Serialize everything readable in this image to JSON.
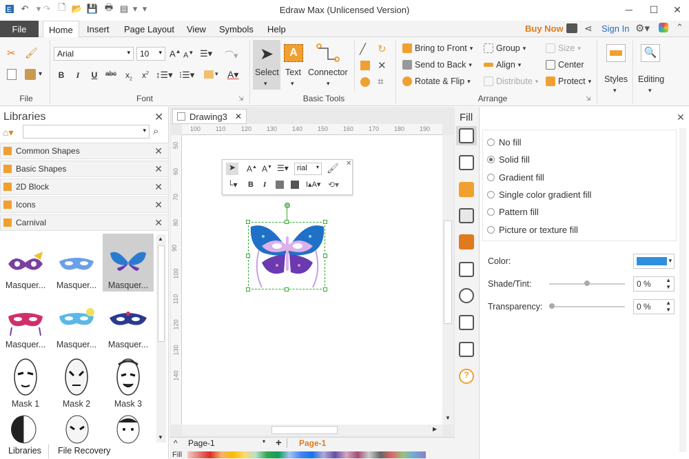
{
  "window": {
    "title": "Edraw Max (Unlicensed Version)"
  },
  "menu_tabs": [
    "File",
    "Home",
    "Insert",
    "Page Layout",
    "View",
    "Symbols",
    "Help"
  ],
  "header_right": {
    "buy_now": "Buy Now",
    "sign_in": "Sign In"
  },
  "ribbon": {
    "file_group": {
      "label": "File"
    },
    "font_group": {
      "label": "Font",
      "font_name": "Arial",
      "font_size": "10"
    },
    "basic_tools": {
      "label": "Basic Tools",
      "select": "Select",
      "text": "Text",
      "connector": "Connector"
    },
    "arrange": {
      "label": "Arrange",
      "bring_to_front": "Bring to Front",
      "send_to_back": "Send to Back",
      "rotate_flip": "Rotate & Flip",
      "group": "Group",
      "align": "Align",
      "distribute": "Distribute",
      "size": "Size",
      "center": "Center",
      "protect": "Protect"
    },
    "styles": "Styles",
    "editing": "Editing"
  },
  "libraries": {
    "title": "Libraries",
    "search_placeholder": "",
    "categories": [
      "Common Shapes",
      "Basic Shapes",
      "2D Block",
      "Icons",
      "Carnival"
    ],
    "shapes": [
      {
        "label": "Masquer..."
      },
      {
        "label": "Masquer..."
      },
      {
        "label": "Masquer..."
      },
      {
        "label": "Masquer..."
      },
      {
        "label": "Masquer..."
      },
      {
        "label": "Masquer..."
      },
      {
        "label": "Mask 1"
      },
      {
        "label": "Mask 2"
      },
      {
        "label": "Mask 3"
      }
    ],
    "bottom_tabs": {
      "libraries": "Libraries",
      "file_recovery": "File Recovery"
    }
  },
  "document": {
    "tab_name": "Drawing3",
    "ruler_h": [
      "100",
      "110",
      "120",
      "130",
      "140",
      "150",
      "160",
      "170",
      "180",
      "190"
    ],
    "ruler_v": [
      "50",
      "60",
      "70",
      "80",
      "90",
      "100",
      "110",
      "120",
      "130",
      "140"
    ],
    "float_toolbar_font": "rial",
    "page_selector": "Page-1",
    "page_tab": "Page-1",
    "fill_label": "Fill"
  },
  "fill_panel": {
    "title": "Fill",
    "options": [
      "No fill",
      "Solid fill",
      "Gradient fill",
      "Single color gradient fill",
      "Pattern fill",
      "Picture or texture fill"
    ],
    "selected": "Solid fill",
    "color_label": "Color:",
    "color_value": "#2f8fdc",
    "shade_label": "Shade/Tint:",
    "shade_value": "0 %",
    "transparency_label": "Transparency:",
    "transparency_value": "0 %"
  },
  "colors": {
    "accent_orange": "#f0a030",
    "file_tab": "#4b4b4b",
    "buy_now": "#e07a1f",
    "sign_in": "#2b6cb0"
  }
}
